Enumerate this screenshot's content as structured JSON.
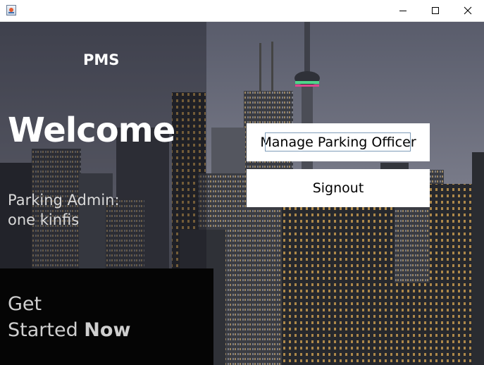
{
  "window": {
    "title": "",
    "controls": [
      "minimize-icon",
      "maximize-icon",
      "close-icon"
    ]
  },
  "left_panel": {
    "app_name": "PMS",
    "welcome": "Welcome",
    "role_label": "Parking Admin:",
    "user_name": "one kinfis",
    "tagline_line1": "Get",
    "tagline_line2_prefix": "Started ",
    "tagline_line2_bold": "Now"
  },
  "actions": {
    "manage_label": "Manage Parking Officer",
    "signout_label": "Signout"
  },
  "colors": {
    "button_bg": "#ffffff",
    "focus_border": "#7f9db9",
    "tagline_panel": "#050505",
    "title_text": "#ffffff",
    "body_text": "#d9d9d9"
  }
}
